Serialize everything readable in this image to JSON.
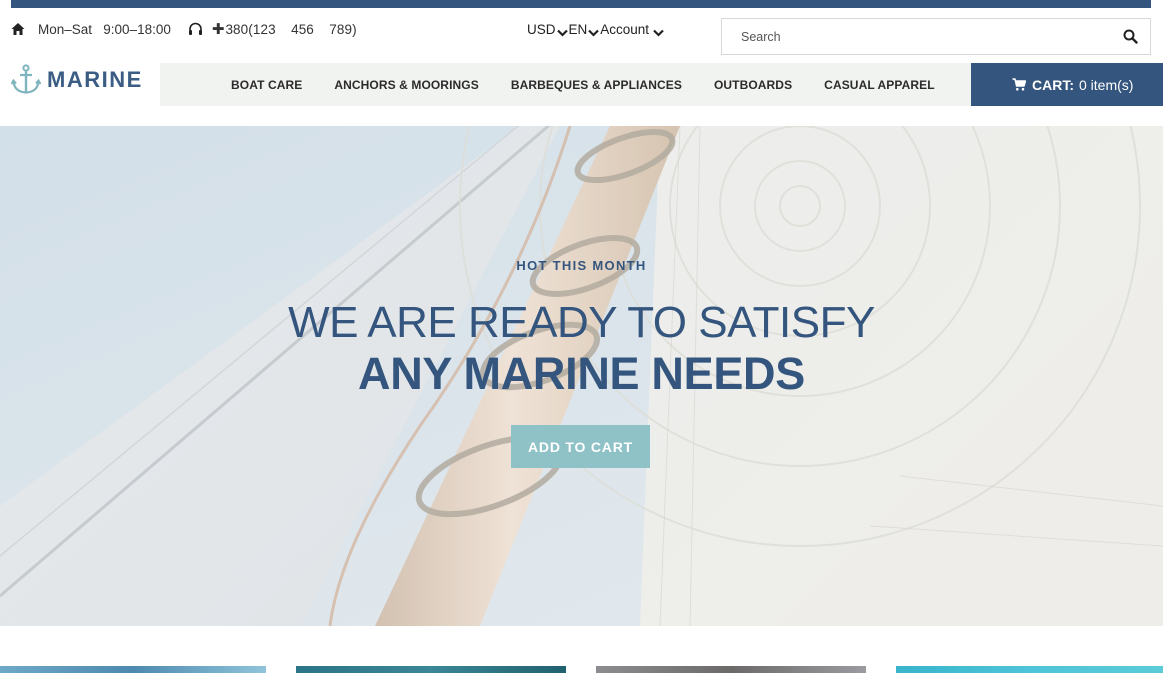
{
  "topbar": {
    "hours": "Mon–Sat   9:00–18:00",
    "phone": "380(123    456    789)",
    "currency": "USD",
    "language": "EN",
    "account": "Account",
    "search_placeholder": "Search"
  },
  "header": {
    "brand": "MARINE",
    "nav": [
      "BOAT CARE",
      "ANCHORS & MOORINGS",
      "BARBEQUES & APPLIANCES",
      "OUTBOARDS",
      "CASUAL APPAREL"
    ],
    "cart_label": "CART:",
    "cart_count": "0 item(s)"
  },
  "hero": {
    "kicker": "HOT THIS MONTH",
    "headline_line1": "WE ARE READY TO SATISFY",
    "headline_line2": "ANY MARINE NEEDS",
    "cta": "ADD TO CART"
  },
  "colors": {
    "primary": "#34557d",
    "accent": "#8fc2c7",
    "nav_bg": "#f1f3f0"
  },
  "icons": [
    "home-icon",
    "headset-icon",
    "plus-icon",
    "chevron-down-icon",
    "search-icon",
    "anchor-icon",
    "cart-icon"
  ]
}
